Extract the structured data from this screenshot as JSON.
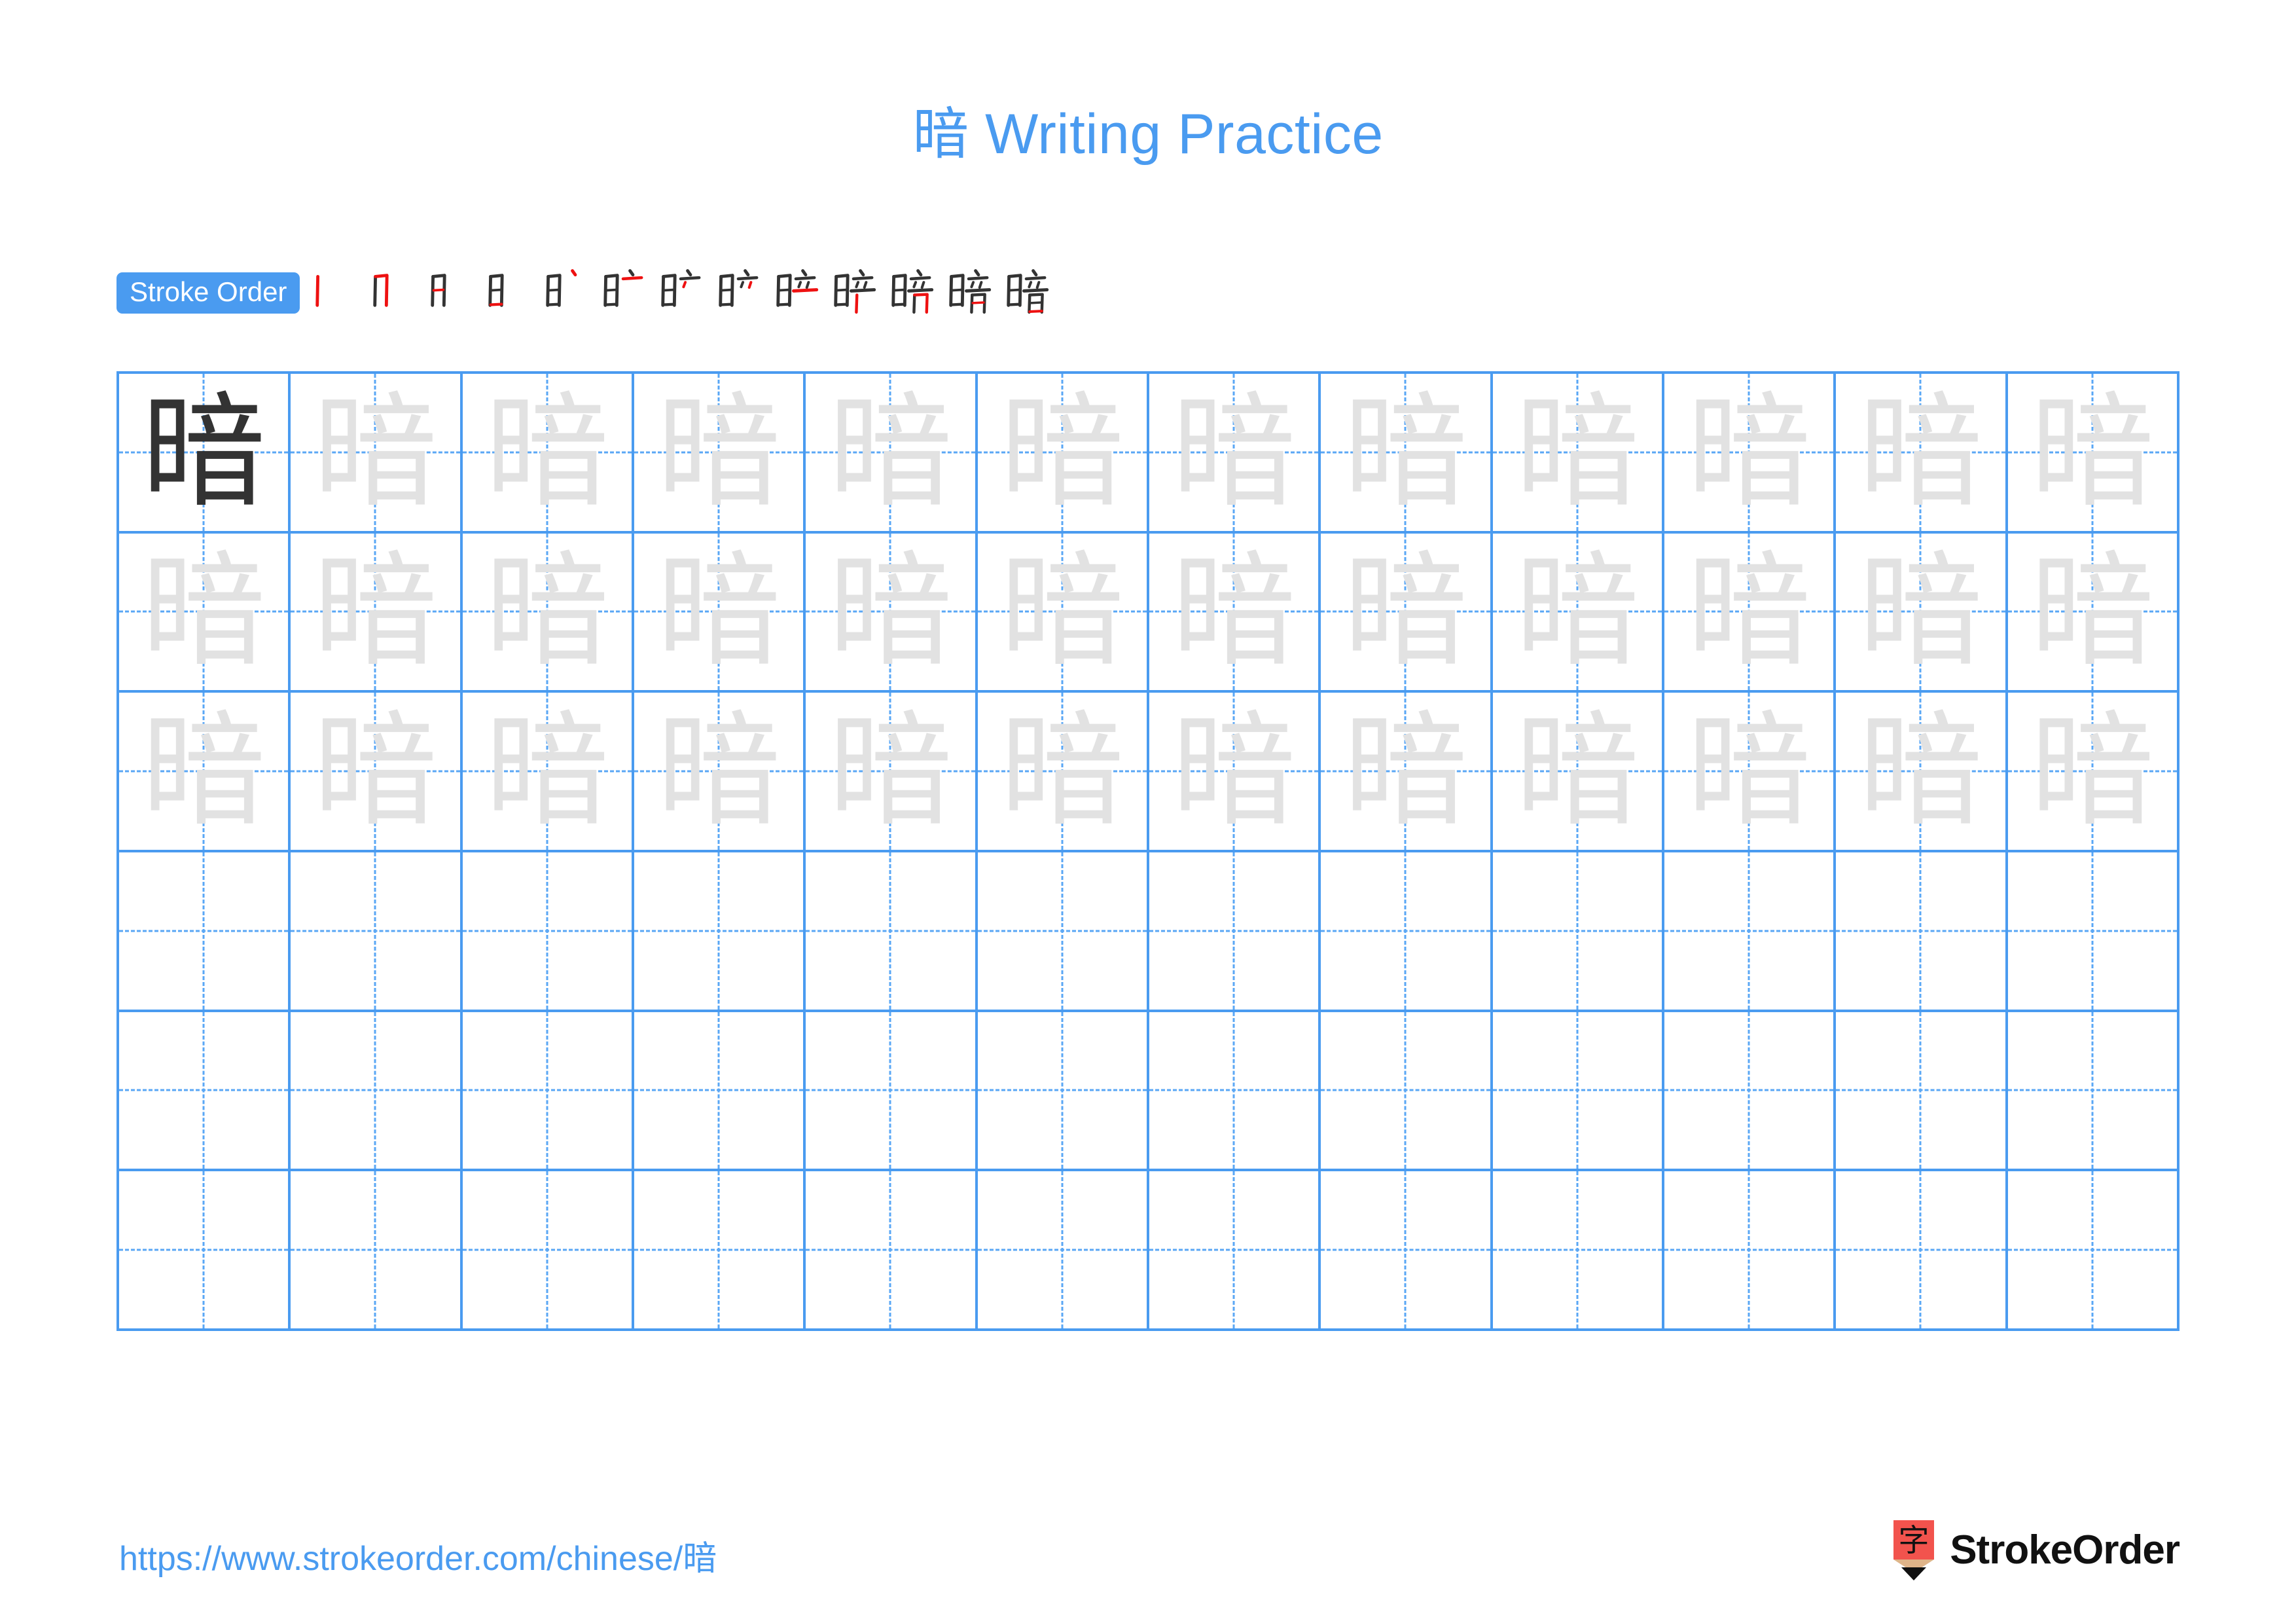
{
  "document": {
    "character": "暗",
    "title": "暗 Writing Practice",
    "title_character": "暗",
    "title_suffix": " Writing Practice"
  },
  "stroke_order": {
    "label": "Stroke Order",
    "stroke_count": 13,
    "steps": [
      {
        "index": 1,
        "partial": "丨",
        "new_stroke": "vertical"
      },
      {
        "index": 2,
        "partial": "冂",
        "new_stroke": "horizontal-fold-vertical"
      },
      {
        "index": 3,
        "partial": "冃",
        "new_stroke": "horizontal-inner"
      },
      {
        "index": 4,
        "partial": "日",
        "new_stroke": "horizontal-bottom"
      },
      {
        "index": 5,
        "partial": "日丶",
        "new_stroke": "dot"
      },
      {
        "index": 6,
        "partial": "日亠",
        "new_stroke": "horizontal"
      },
      {
        "index": 7,
        "partial": "日亠丶",
        "new_stroke": "left-dot"
      },
      {
        "index": 8,
        "partial": "日立上",
        "new_stroke": "right-dot"
      },
      {
        "index": 9,
        "partial": "日立",
        "new_stroke": "horizontal-long"
      },
      {
        "index": 10,
        "partial": "晬",
        "new_stroke": "vertical-mouth-left"
      },
      {
        "index": 11,
        "partial": "晻",
        "new_stroke": "fold"
      },
      {
        "index": 12,
        "partial": "暗",
        "new_stroke": "horizontal-inner-mouth"
      },
      {
        "index": 13,
        "partial": "暗",
        "new_stroke": "horizontal-bottom-mouth"
      }
    ]
  },
  "practice_grid": {
    "columns": 12,
    "rows": 6,
    "cells": [
      [
        {
          "char": "暗",
          "style": "dark"
        },
        {
          "char": "暗",
          "style": "light"
        },
        {
          "char": "暗",
          "style": "light"
        },
        {
          "char": "暗",
          "style": "light"
        },
        {
          "char": "暗",
          "style": "light"
        },
        {
          "char": "暗",
          "style": "light"
        },
        {
          "char": "暗",
          "style": "light"
        },
        {
          "char": "暗",
          "style": "light"
        },
        {
          "char": "暗",
          "style": "light"
        },
        {
          "char": "暗",
          "style": "light"
        },
        {
          "char": "暗",
          "style": "light"
        },
        {
          "char": "暗",
          "style": "light"
        }
      ],
      [
        {
          "char": "暗",
          "style": "light"
        },
        {
          "char": "暗",
          "style": "light"
        },
        {
          "char": "暗",
          "style": "light"
        },
        {
          "char": "暗",
          "style": "light"
        },
        {
          "char": "暗",
          "style": "light"
        },
        {
          "char": "暗",
          "style": "light"
        },
        {
          "char": "暗",
          "style": "light"
        },
        {
          "char": "暗",
          "style": "light"
        },
        {
          "char": "暗",
          "style": "light"
        },
        {
          "char": "暗",
          "style": "light"
        },
        {
          "char": "暗",
          "style": "light"
        },
        {
          "char": "暗",
          "style": "light"
        }
      ],
      [
        {
          "char": "暗",
          "style": "light"
        },
        {
          "char": "暗",
          "style": "light"
        },
        {
          "char": "暗",
          "style": "light"
        },
        {
          "char": "暗",
          "style": "light"
        },
        {
          "char": "暗",
          "style": "light"
        },
        {
          "char": "暗",
          "style": "light"
        },
        {
          "char": "暗",
          "style": "light"
        },
        {
          "char": "暗",
          "style": "light"
        },
        {
          "char": "暗",
          "style": "light"
        },
        {
          "char": "暗",
          "style": "light"
        },
        {
          "char": "暗",
          "style": "light"
        },
        {
          "char": "暗",
          "style": "light"
        }
      ],
      [
        {
          "char": "",
          "style": "empty"
        },
        {
          "char": "",
          "style": "empty"
        },
        {
          "char": "",
          "style": "empty"
        },
        {
          "char": "",
          "style": "empty"
        },
        {
          "char": "",
          "style": "empty"
        },
        {
          "char": "",
          "style": "empty"
        },
        {
          "char": "",
          "style": "empty"
        },
        {
          "char": "",
          "style": "empty"
        },
        {
          "char": "",
          "style": "empty"
        },
        {
          "char": "",
          "style": "empty"
        },
        {
          "char": "",
          "style": "empty"
        },
        {
          "char": "",
          "style": "empty"
        }
      ],
      [
        {
          "char": "",
          "style": "empty"
        },
        {
          "char": "",
          "style": "empty"
        },
        {
          "char": "",
          "style": "empty"
        },
        {
          "char": "",
          "style": "empty"
        },
        {
          "char": "",
          "style": "empty"
        },
        {
          "char": "",
          "style": "empty"
        },
        {
          "char": "",
          "style": "empty"
        },
        {
          "char": "",
          "style": "empty"
        },
        {
          "char": "",
          "style": "empty"
        },
        {
          "char": "",
          "style": "empty"
        },
        {
          "char": "",
          "style": "empty"
        },
        {
          "char": "",
          "style": "empty"
        }
      ],
      [
        {
          "char": "",
          "style": "empty"
        },
        {
          "char": "",
          "style": "empty"
        },
        {
          "char": "",
          "style": "empty"
        },
        {
          "char": "",
          "style": "empty"
        },
        {
          "char": "",
          "style": "empty"
        },
        {
          "char": "",
          "style": "empty"
        },
        {
          "char": "",
          "style": "empty"
        },
        {
          "char": "",
          "style": "empty"
        },
        {
          "char": "",
          "style": "empty"
        },
        {
          "char": "",
          "style": "empty"
        },
        {
          "char": "",
          "style": "empty"
        },
        {
          "char": "",
          "style": "empty"
        }
      ]
    ]
  },
  "footer": {
    "url": "https://www.strokeorder.com/chinese/暗",
    "brand_name": "StrokeOrder",
    "logo_character": "字"
  },
  "colors": {
    "accent_blue": "#4a9bf0",
    "grid_line": "#4a9bf0",
    "grid_dash": "#5aa7f5",
    "char_dark": "#333333",
    "char_light": "#e2e2e2",
    "new_stroke_red": "#ee1111",
    "logo_red": "#f2534d",
    "logo_wood": "#dfb489",
    "text_black": "#111111"
  }
}
